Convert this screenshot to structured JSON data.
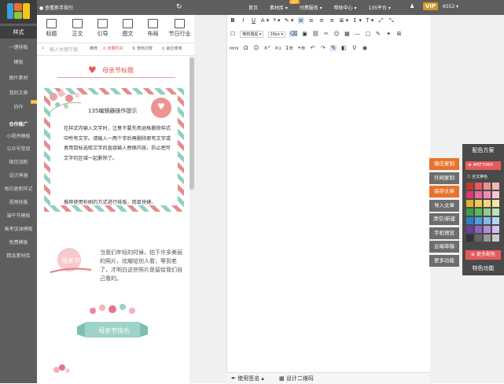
{
  "topbar": {
    "notice": "查看新手指引",
    "menu": [
      "首页",
      "素材库 ▾",
      "付费服务 ▾",
      "帮助中心 ▾",
      "135平台 ▾"
    ],
    "hot_badge": "HOT",
    "vip": "VIP",
    "user_id": "6552 ▾"
  },
  "sidebar": {
    "items": [
      "样式",
      "一键排版",
      "模板",
      "图片素材",
      "我的文章",
      "协作",
      "合作推广",
      "小程序模板",
      "公众号变现",
      "微信加粉",
      "设计神器",
      "每日更新样式",
      "视频排版",
      "端午节模板",
      "高考加油模板",
      "免费模板",
      "精品素材库"
    ],
    "new_badge": "new"
  },
  "tabs": [
    "标题",
    "正文",
    "引导",
    "图文",
    "布局",
    "节日行业"
  ],
  "search": {
    "placeholder": "输入关键字搜",
    "sort": [
      "推荐",
      "收藏时间",
      "使用次数",
      "最近使用"
    ]
  },
  "template": {
    "heading": "母亲节标题",
    "stamp_title": "135编辑器操作提示",
    "stamp_text": "在样式内输入文字时，注意不要先用退格删除样式中所有文字。请输入一两个字后再删除原有文字或者用鼠标选取文字后直接输入替换内容，防止把写文字的区域一起删除了。",
    "stamp_text2": "推荐使用秒刷的方式进行排版，简单快捷。",
    "circle_text": "母亲节",
    "poem": "当我们年轻的时候，拍下许多美丽的照片，炫耀给别人看；等到老了，才明白这些照片是留给我们自己看的。",
    "banner": "母亲节快乐"
  },
  "toolbar": {
    "row1": [
      "B",
      "I",
      "U",
      "A ▾",
      "ª ▾",
      "✎ ▾",
      "≡",
      "≡",
      "≡",
      "≡",
      "≣ ▾",
      "↕ ▾",
      "T ▾",
      "⤢",
      "⤡"
    ],
    "font": "微软雅黑",
    "size": "16px",
    "row3": [
      "Ω",
      "☺",
      "×²",
      "×₂",
      "1≡",
      "•≡",
      "↶",
      "↷"
    ]
  },
  "footer": {
    "sign": "使用签名 ▴",
    "qrcode": "设计二维码"
  },
  "actions": [
    {
      "label": "微信复制",
      "style": "orange"
    },
    {
      "label": "外网复制",
      "style": "gray"
    },
    {
      "label": "保存文章",
      "style": "orange"
    },
    {
      "label": "导入文章",
      "style": "gray"
    },
    {
      "label": "清空/新建",
      "style": "gray"
    },
    {
      "label": "手机预览",
      "style": "gray"
    },
    {
      "label": "云端草稿",
      "style": "gray"
    },
    {
      "label": "更多功能",
      "style": "gray"
    }
  ],
  "colors": {
    "title": "配色方案",
    "current": "#EF7060",
    "all_label": "全文换色",
    "more": "更多配色",
    "special": "特色功能",
    "swatches": [
      "#c0392b",
      "#e45b5b",
      "#ef8e8e",
      "#f4b6b6",
      "#d43b72",
      "#e86c9a",
      "#f08db4",
      "#f9c5d9",
      "#e0b030",
      "#f0c850",
      "#f3d777",
      "#f6e6a2",
      "#3aa04a",
      "#5cb85c",
      "#8fce8f",
      "#bde3bd",
      "#2e7fc9",
      "#4a9ee0",
      "#7dbbed",
      "#b5d7f5",
      "#6a3fa0",
      "#8e63c0",
      "#b190d6",
      "#d6c2ec",
      "#333333",
      "#666666",
      "#999999",
      "#cccccc"
    ],
    "brand": "#e8732c"
  }
}
